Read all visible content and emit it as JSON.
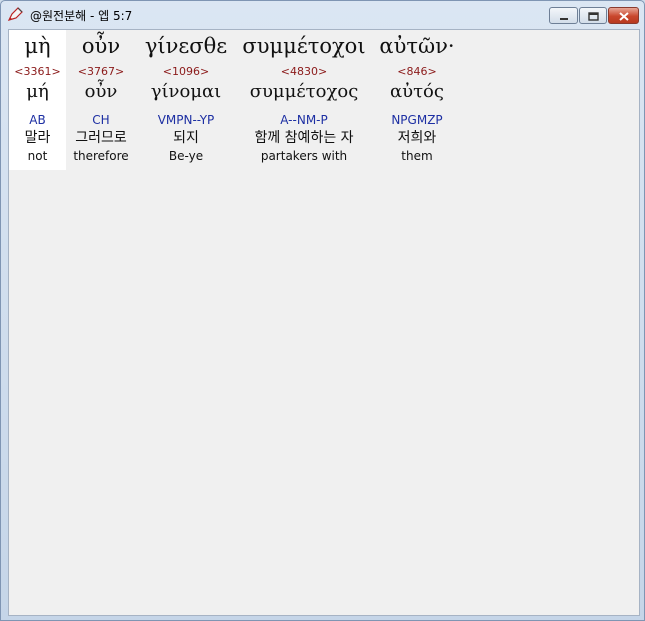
{
  "window": {
    "title": "@원전분해 - 엡 5:7"
  },
  "words": [
    {
      "greek": "μὴ",
      "strong": "<3361>",
      "lemma": "μή",
      "morph": "AB",
      "korean": "말라",
      "english": "not"
    },
    {
      "greek": "οὖν",
      "strong": "<3767>",
      "lemma": "οὖν",
      "morph": "CH",
      "korean": "그러므로",
      "english": "therefore"
    },
    {
      "greek": "γίνεσθε",
      "strong": "<1096>",
      "lemma": "γίνομαι",
      "morph": "VMPN--YP",
      "korean": "되지",
      "english": "Be-ye"
    },
    {
      "greek": "συμμέτοχοι",
      "strong": "<4830>",
      "lemma": "συμμέτοχος",
      "morph": "A--NM-P",
      "korean": "함께 참예하는 자",
      "english": "partakers with"
    },
    {
      "greek": "αὐτῶν·",
      "strong": "<846>",
      "lemma": "αὐτός",
      "morph": "NPGMZP",
      "korean": "저희와",
      "english": "them"
    }
  ],
  "colors": {
    "strong": "#8b1a1a",
    "morph": "#1d2fa3",
    "selected_bg": "#ffffff",
    "content_bg": "#f0f0f0"
  },
  "icons": {
    "app": "pen-icon",
    "minimize": "minimize-icon",
    "maximize": "maximize-icon",
    "close": "close-icon"
  }
}
